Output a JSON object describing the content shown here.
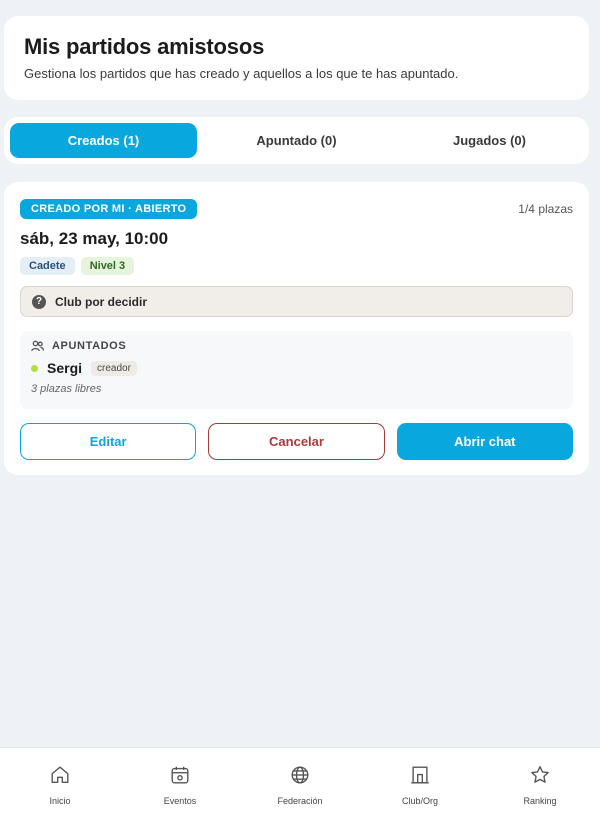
{
  "header": {
    "title": "Mis partidos amistosos",
    "subtitle": "Gestiona los partidos que has creado y aquellos a los que te has apuntado."
  },
  "tabs": [
    {
      "label": "Creados (1)",
      "active": true
    },
    {
      "label": "Apuntado (0)",
      "active": false
    },
    {
      "label": "Jugados (0)",
      "active": false
    }
  ],
  "match": {
    "status": "CREADO POR MI · ABIERTO",
    "slots": "1/4 plazas",
    "date": "sáb, 23 may, 10:00",
    "tags": [
      "Cadete",
      "Nivel 3"
    ],
    "club": "Club por decidir",
    "players_heading": "APUNTADOS",
    "players": [
      {
        "name": "Sergi",
        "role": "creador"
      }
    ],
    "free_slots": "3 plazas libres",
    "actions": {
      "edit": "Editar",
      "cancel": "Cancelar",
      "chat": "Abrir chat"
    }
  },
  "bottom_nav": [
    {
      "label": "Inicio",
      "icon": "home-icon"
    },
    {
      "label": "Eventos",
      "icon": "calendar-icon"
    },
    {
      "label": "Federación",
      "icon": "globe-icon"
    },
    {
      "label": "Club/Org",
      "icon": "building-icon"
    },
    {
      "label": "Ranking",
      "icon": "star-icon"
    }
  ],
  "colors": {
    "accent": "#08a8de",
    "danger": "#a83a3a",
    "background": "#eef2f6"
  }
}
